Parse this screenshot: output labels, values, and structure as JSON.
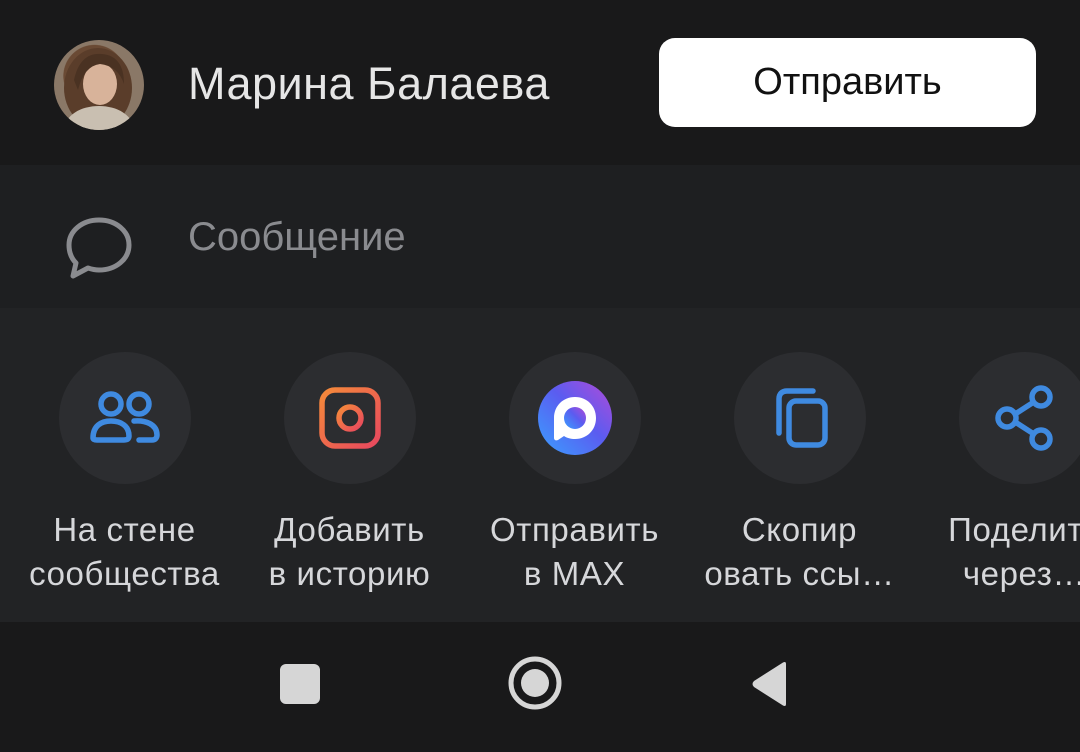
{
  "recipient": {
    "name": "Марина Балаева",
    "send_label": "Отправить"
  },
  "message": {
    "placeholder": "Сообщение",
    "value": ""
  },
  "actions": [
    {
      "line1": "На стене",
      "line2": "сообщества",
      "icon": "users-icon"
    },
    {
      "line1": "Добавить",
      "line2": "в историю",
      "icon": "story-icon"
    },
    {
      "line1": "Отправить",
      "line2": "в MAX",
      "icon": "max-app-icon"
    },
    {
      "line1": "Скопир",
      "line2": "овать ссы…",
      "icon": "copy-icon"
    },
    {
      "line1": "Поделить",
      "line2": "через…",
      "icon": "share-icon"
    }
  ],
  "nav": {
    "recents": "square-icon",
    "home": "circle-icon",
    "back": "triangle-back-icon"
  },
  "colors": {
    "accent_blue": "#3f8ae0",
    "story_orange": "#f36b4b",
    "send_button_bg": "#ffffff",
    "background": "#19191a"
  }
}
